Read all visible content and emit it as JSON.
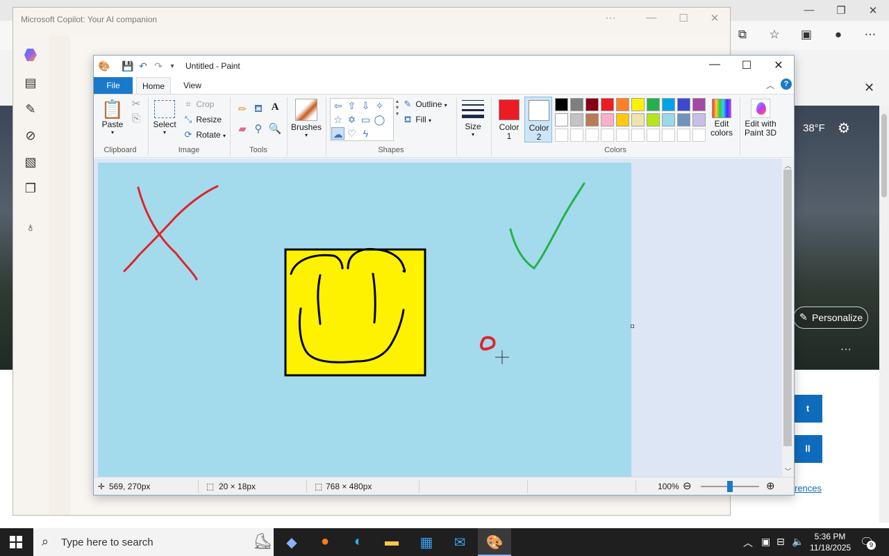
{
  "edge": {
    "window_controls": {
      "minimize": "—",
      "restore": "❐",
      "close": "✕"
    },
    "toolbar_icons": [
      "extensions-icon",
      "favorites-icon",
      "collections-icon",
      "profile-icon",
      "more-icon"
    ],
    "close_glyph": "✕",
    "weather_temp": "38°F",
    "personalize_label": "Personalize",
    "more_glyph": "···",
    "button_partial_1": "t",
    "button_partial_2": "ll",
    "preferences_link": "rences"
  },
  "copilot": {
    "title": "Microsoft Copilot: Your AI companion",
    "window_controls": {
      "more": "···",
      "minimize": "—",
      "maximize": "☐",
      "close": "✕"
    }
  },
  "paint": {
    "title": "Untitled - Paint",
    "window_controls": {
      "minimize": "—",
      "maximize": "☐",
      "close": "✕"
    },
    "tabs": {
      "file": "File",
      "home": "Home",
      "view": "View"
    },
    "help": "?",
    "clipboard": {
      "paste": "Paste",
      "group": "Clipboard"
    },
    "image": {
      "select": "Select",
      "crop": "Crop",
      "resize": "Resize",
      "rotate": "Rotate",
      "group": "Image"
    },
    "tools": {
      "group": "Tools"
    },
    "brushes": {
      "label": "Brushes"
    },
    "shapes": {
      "outline": "Outline",
      "fill": "Fill",
      "group": "Shapes"
    },
    "size": {
      "label": "Size"
    },
    "colors": {
      "color1_label": "Color\n1",
      "color2_label": "Color\n2",
      "color1": "#ed1c24",
      "color2": "#ffffff",
      "edit_colors": "Edit\ncolors",
      "group": "Colors",
      "palette_row1": [
        "#000000",
        "#7f7f7f",
        "#880015",
        "#ed1c24",
        "#ff7f27",
        "#fff200",
        "#22b14c",
        "#00a2e8",
        "#3f48cc",
        "#a349a4"
      ],
      "palette_row2": [
        "#ffffff",
        "#c3c3c3",
        "#b97a57",
        "#ffaec9",
        "#ffc90e",
        "#efe4b0",
        "#b5e61d",
        "#99d9ea",
        "#7092be",
        "#c8bfe7"
      ],
      "palette_row3": [
        "#ffffff",
        "#ffffff",
        "#ffffff",
        "#ffffff",
        "#ffffff",
        "#ffffff",
        "#ffffff",
        "#ffffff",
        "#ffffff",
        "#ffffff"
      ]
    },
    "paint3d": {
      "label": "Edit with\nPaint 3D"
    },
    "canvas": {
      "background": "#a3dbec",
      "strokes": {
        "red": "#e0232b",
        "green": "#25b14c",
        "black": "#000000",
        "yellow": "#fff200"
      }
    },
    "status": {
      "cursor_pos": "569, 270px",
      "selection_size": "20 × 18px",
      "image_size": "768 × 480px",
      "zoom": "100%"
    }
  },
  "taskbar": {
    "search_placeholder": "Type here to search",
    "time": "5:36 PM",
    "date": "11/18/2025",
    "notification_count": "9"
  }
}
